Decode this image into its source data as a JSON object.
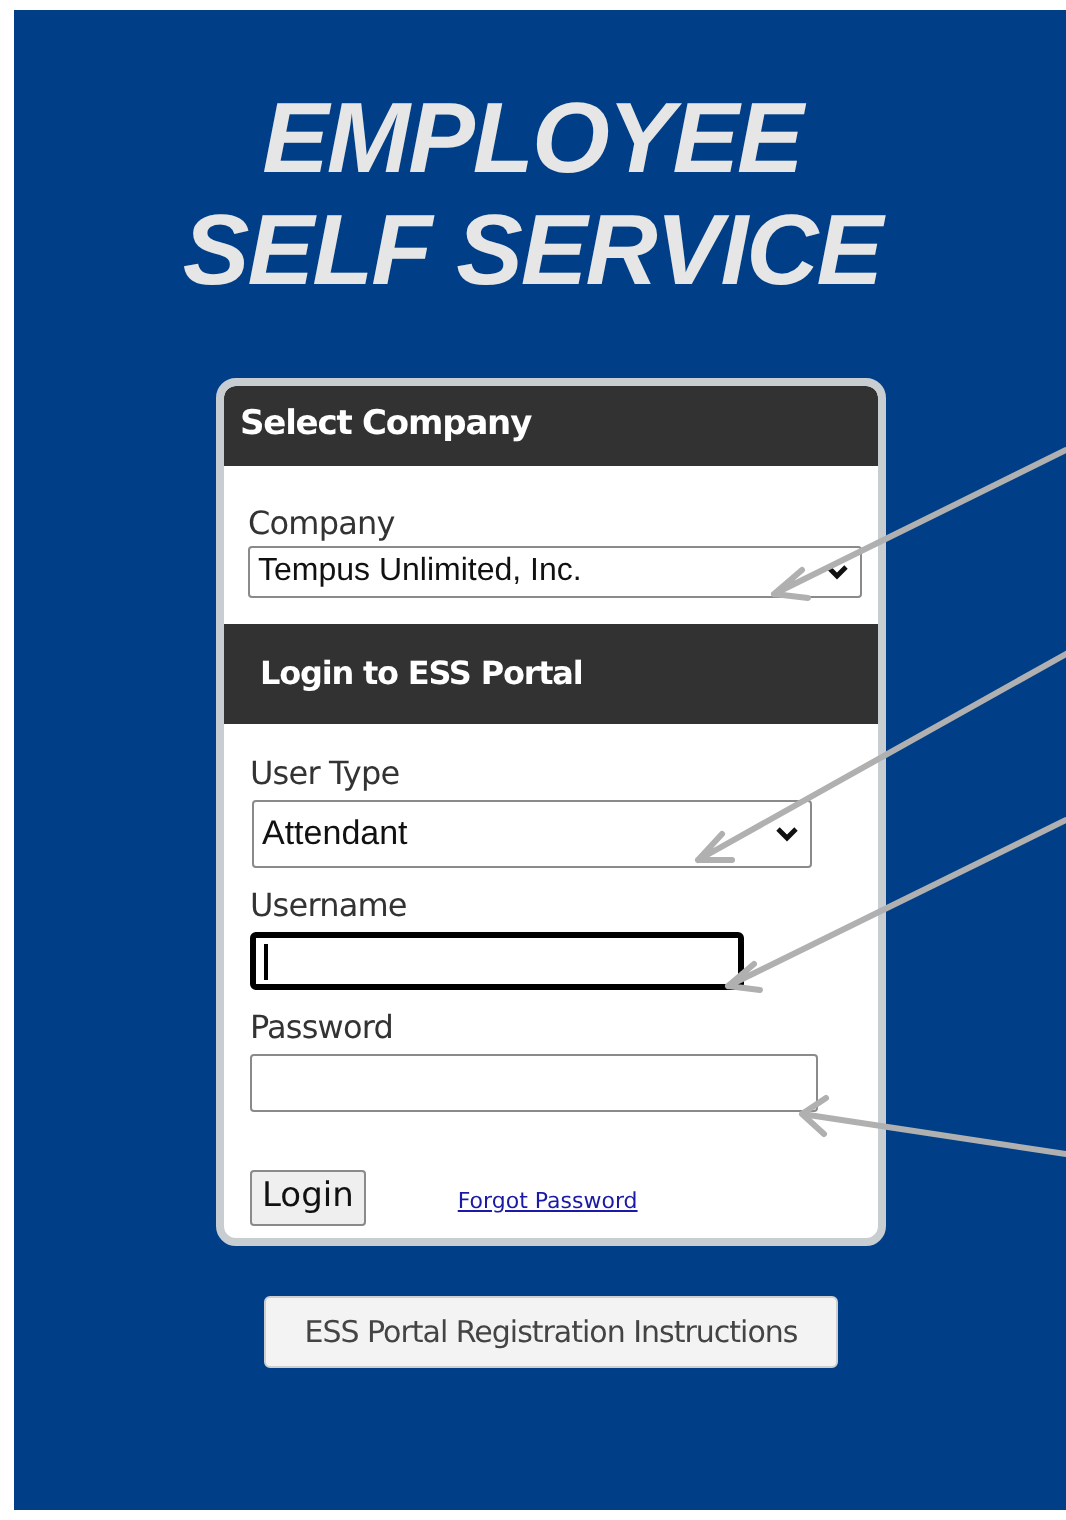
{
  "title": {
    "lines": [
      "EMPLOYEE",
      "SELF SERVICE"
    ]
  },
  "sections": [
    {
      "heading": "Select Company",
      "fields": [
        {
          "kind": "select",
          "label": "Company",
          "value": "Tempus Unlimited, Inc.",
          "focused": false
        }
      ]
    },
    {
      "heading": "Login to ESS Portal",
      "fields": [
        {
          "kind": "select",
          "label": "User Type",
          "value": "Attendant",
          "focused": false
        },
        {
          "kind": "text",
          "label": "Username",
          "focused": true
        },
        {
          "kind": "text",
          "label": "Password",
          "focused": false
        }
      ]
    }
  ],
  "login_button": "Login",
  "forgot_link": "Forgot Password",
  "registration_button": "ESS Portal Registration Instructions"
}
